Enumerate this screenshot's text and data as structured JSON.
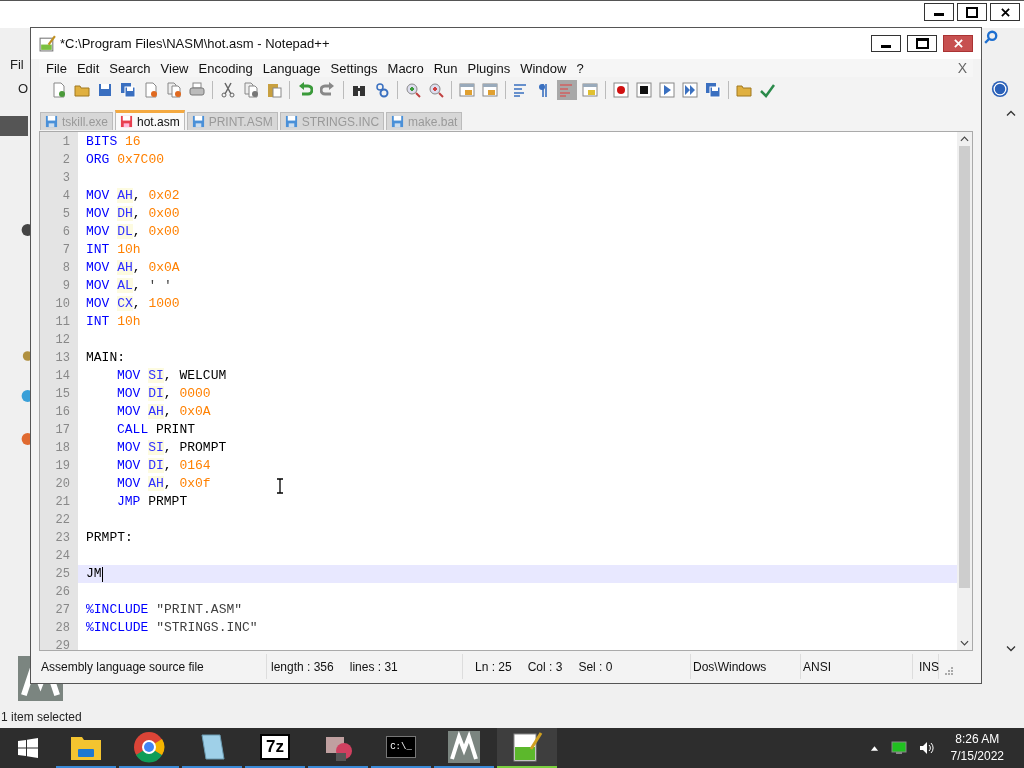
{
  "background_window": {
    "menu_fragments": [
      "Fil",
      "O"
    ],
    "status_text": "1 item selected"
  },
  "window": {
    "title": "*C:\\Program Files\\NASM\\hot.asm - Notepad++"
  },
  "menu": [
    "File",
    "Edit",
    "Search",
    "View",
    "Encoding",
    "Language",
    "Settings",
    "Macro",
    "Run",
    "Plugins",
    "Window",
    "?"
  ],
  "menu_close": "X",
  "toolbar_groups": [
    [
      {
        "kind": "new",
        "pressed": false
      },
      {
        "kind": "open",
        "pressed": false
      },
      {
        "kind": "save",
        "pressed": false
      },
      {
        "kind": "save_all",
        "pressed": false
      },
      {
        "kind": "close",
        "pressed": false
      },
      {
        "kind": "close_all",
        "pressed": false
      },
      {
        "kind": "print",
        "pressed": false
      }
    ],
    [
      {
        "kind": "cut",
        "pressed": false
      },
      {
        "kind": "copy",
        "pressed": false
      },
      {
        "kind": "paste",
        "pressed": false
      }
    ],
    [
      {
        "kind": "undo",
        "pressed": false
      },
      {
        "kind": "redo",
        "pressed": false
      }
    ],
    [
      {
        "kind": "find",
        "pressed": false
      },
      {
        "kind": "replace",
        "pressed": false
      }
    ],
    [
      {
        "kind": "zoom_in",
        "pressed": false
      },
      {
        "kind": "zoom_out",
        "pressed": false
      }
    ],
    [
      {
        "kind": "sync_v",
        "pressed": false
      },
      {
        "kind": "sync_h",
        "pressed": false
      }
    ],
    [
      {
        "kind": "wrap",
        "pressed": false
      },
      {
        "kind": "all_chars",
        "pressed": false
      },
      {
        "kind": "indent_guide",
        "pressed": true
      },
      {
        "kind": "doc_map",
        "pressed": false
      }
    ],
    [
      {
        "kind": "record",
        "pressed": false
      },
      {
        "kind": "stop",
        "pressed": false
      },
      {
        "kind": "play",
        "pressed": false
      },
      {
        "kind": "play_multi",
        "pressed": false
      },
      {
        "kind": "save_macro",
        "pressed": false
      }
    ],
    [
      {
        "kind": "folder",
        "pressed": false
      },
      {
        "kind": "spellcheck",
        "pressed": false
      }
    ]
  ],
  "tabs": [
    {
      "label": "tskill.exe",
      "selected": false,
      "modified": false
    },
    {
      "label": "hot.asm",
      "selected": true,
      "modified": true
    },
    {
      "label": "PRINT.ASM",
      "selected": false,
      "modified": false
    },
    {
      "label": "STRINGS.INC",
      "selected": false,
      "modified": false
    },
    {
      "label": "make.bat",
      "selected": false,
      "modified": false
    }
  ],
  "editor": {
    "lines": [
      {
        "number": "1",
        "current": false,
        "indent": false,
        "tokens": [
          {
            "text": "BITS ",
            "kind": "instr"
          },
          {
            "text": "16",
            "kind": "num"
          }
        ]
      },
      {
        "number": "2",
        "current": false,
        "indent": false,
        "tokens": [
          {
            "text": "ORG ",
            "kind": "instr"
          },
          {
            "text": "0x7C00",
            "kind": "num"
          }
        ]
      },
      {
        "number": "3",
        "current": false
      },
      {
        "number": "4",
        "current": false,
        "indent": false,
        "tokens": [
          {
            "text": "MOV ",
            "kind": "instr"
          },
          {
            "text": "AH",
            "kind": "reg"
          },
          {
            "text": ", ",
            "kind": "plain"
          },
          {
            "text": "0x02",
            "kind": "num"
          }
        ]
      },
      {
        "number": "5",
        "current": false,
        "indent": false,
        "tokens": [
          {
            "text": "MOV ",
            "kind": "instr"
          },
          {
            "text": "DH",
            "kind": "reg"
          },
          {
            "text": ", ",
            "kind": "plain"
          },
          {
            "text": "0x00",
            "kind": "num"
          }
        ]
      },
      {
        "number": "6",
        "current": false,
        "indent": false,
        "tokens": [
          {
            "text": "MOV ",
            "kind": "instr"
          },
          {
            "text": "DL",
            "kind": "reg"
          },
          {
            "text": ", ",
            "kind": "plain"
          },
          {
            "text": "0x00",
            "kind": "num"
          }
        ]
      },
      {
        "number": "7",
        "current": false,
        "indent": false,
        "tokens": [
          {
            "text": "INT ",
            "kind": "instr"
          },
          {
            "text": "10h",
            "kind": "num"
          }
        ]
      },
      {
        "number": "8",
        "current": false,
        "indent": false,
        "tokens": [
          {
            "text": "MOV ",
            "kind": "instr"
          },
          {
            "text": "AH",
            "kind": "reg"
          },
          {
            "text": ", ",
            "kind": "plain"
          },
          {
            "text": "0x0A",
            "kind": "num"
          }
        ]
      },
      {
        "number": "9",
        "current": false,
        "indent": false,
        "tokens": [
          {
            "text": "MOV ",
            "kind": "instr"
          },
          {
            "text": "AL",
            "kind": "reg"
          },
          {
            "text": ", ",
            "kind": "plain"
          },
          {
            "text": "' '",
            "kind": "str"
          }
        ]
      },
      {
        "number": "10",
        "current": false,
        "indent": false,
        "tokens": [
          {
            "text": "MOV ",
            "kind": "instr"
          },
          {
            "text": "CX",
            "kind": "reg"
          },
          {
            "text": ", ",
            "kind": "plain"
          },
          {
            "text": "1000",
            "kind": "num"
          }
        ]
      },
      {
        "number": "11",
        "current": false,
        "indent": false,
        "tokens": [
          {
            "text": "INT ",
            "kind": "instr"
          },
          {
            "text": "10h",
            "kind": "num"
          }
        ]
      },
      {
        "number": "12",
        "current": false
      },
      {
        "number": "13",
        "current": false,
        "indent": false,
        "tokens": [
          {
            "text": "MAIN:",
            "kind": "plain"
          }
        ]
      },
      {
        "number": "14",
        "current": false,
        "indent": true,
        "tokens": [
          {
            "text": "MOV ",
            "kind": "instr"
          },
          {
            "text": "SI",
            "kind": "reg"
          },
          {
            "text": ", WELCUM",
            "kind": "plain"
          }
        ]
      },
      {
        "number": "15",
        "current": false,
        "indent": true,
        "tokens": [
          {
            "text": "MOV ",
            "kind": "instr"
          },
          {
            "text": "DI",
            "kind": "reg"
          },
          {
            "text": ", ",
            "kind": "plain"
          },
          {
            "text": "0000",
            "kind": "num"
          }
        ]
      },
      {
        "number": "16",
        "current": false,
        "indent": true,
        "tokens": [
          {
            "text": "MOV ",
            "kind": "instr"
          },
          {
            "text": "AH",
            "kind": "reg"
          },
          {
            "text": ", ",
            "kind": "plain"
          },
          {
            "text": "0x0A",
            "kind": "num"
          }
        ]
      },
      {
        "number": "17",
        "current": false,
        "indent": true,
        "tokens": [
          {
            "text": "CALL ",
            "kind": "instr"
          },
          {
            "text": "PRINT",
            "kind": "plain"
          }
        ]
      },
      {
        "number": "18",
        "current": false,
        "indent": true,
        "tokens": [
          {
            "text": "MOV ",
            "kind": "instr"
          },
          {
            "text": "SI",
            "kind": "reg"
          },
          {
            "text": ", PROMPT",
            "kind": "plain"
          }
        ]
      },
      {
        "number": "19",
        "current": false,
        "indent": true,
        "tokens": [
          {
            "text": "MOV ",
            "kind": "instr"
          },
          {
            "text": "DI",
            "kind": "reg"
          },
          {
            "text": ", ",
            "kind": "plain"
          },
          {
            "text": "0164",
            "kind": "num"
          }
        ]
      },
      {
        "number": "20",
        "current": false,
        "indent": true,
        "tokens": [
          {
            "text": "MOV ",
            "kind": "instr"
          },
          {
            "text": "AH",
            "kind": "reg"
          },
          {
            "text": ", ",
            "kind": "plain"
          },
          {
            "text": "0x0f",
            "kind": "num"
          }
        ]
      },
      {
        "number": "21",
        "current": false,
        "indent": true,
        "tokens": [
          {
            "text": "JMP ",
            "kind": "instr"
          },
          {
            "text": "PRMPT",
            "kind": "plain"
          }
        ]
      },
      {
        "number": "22",
        "current": false
      },
      {
        "number": "23",
        "current": false,
        "indent": false,
        "tokens": [
          {
            "text": "PRMPT:",
            "kind": "plain"
          }
        ]
      },
      {
        "number": "24",
        "current": false
      },
      {
        "number": "25",
        "current": true,
        "indent": false,
        "tokens": [
          {
            "text": "JM",
            "kind": "plain"
          }
        ]
      },
      {
        "number": "26",
        "current": false
      },
      {
        "number": "27",
        "current": false,
        "indent": false,
        "tokens": [
          {
            "text": "%INCLUDE ",
            "kind": "directive"
          },
          {
            "text": "\"PRINT.ASM\"",
            "kind": "str"
          }
        ]
      },
      {
        "number": "28",
        "current": false,
        "indent": false,
        "tokens": [
          {
            "text": "%INCLUDE ",
            "kind": "directive"
          },
          {
            "text": "\"STRINGS.INC\"",
            "kind": "str"
          }
        ]
      },
      {
        "number": "29",
        "current": false
      }
    ]
  },
  "status_bar": [
    [
      "Assembly language source file"
    ],
    [
      "length : 356",
      "lines : 31"
    ],
    [
      "Ln : 25",
      "Col : 3",
      "Sel : 0"
    ],
    [
      "Dos\\Windows"
    ],
    [
      "ANSI"
    ],
    [
      "INS"
    ]
  ],
  "taskbar": {
    "apps": [
      {
        "kind": "explorer",
        "selected": false
      },
      {
        "kind": "chrome",
        "selected": false
      },
      {
        "kind": "notepad",
        "selected": false
      },
      {
        "kind": "sevenzip",
        "label": "7z",
        "selected": false
      },
      {
        "kind": "installer",
        "selected": false
      },
      {
        "kind": "cmd",
        "label": "C:\\_",
        "selected": false
      },
      {
        "kind": "m_app",
        "selected": false
      },
      {
        "kind": "notepadpp",
        "selected": true
      }
    ],
    "time": "8:26 AM",
    "date": "7/15/2022"
  }
}
